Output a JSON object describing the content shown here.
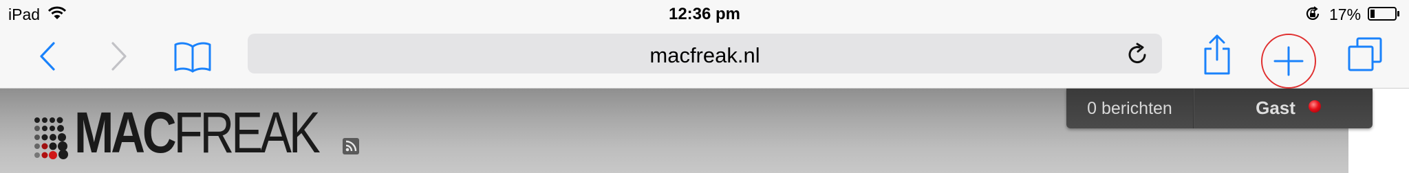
{
  "status_bar": {
    "device": "iPad",
    "time": "12:36 pm",
    "battery": "17%"
  },
  "toolbar": {
    "url": "macfreak.nl",
    "icons": {
      "back": "chevron-left-icon",
      "forward": "chevron-right-icon",
      "bookmarks": "book-icon",
      "reload": "reload-icon",
      "share": "share-icon",
      "new_tab": "plus-icon",
      "tabs": "tabs-icon"
    },
    "accent_color": "#1a82fb",
    "new_tab_highlight_color": "#e03030"
  },
  "site": {
    "logo": {
      "bold": "MAC",
      "regular": "FREAK"
    },
    "user_panel": {
      "messages": "0 berichten",
      "user": "Gast",
      "status_color": "#e8101a"
    }
  }
}
